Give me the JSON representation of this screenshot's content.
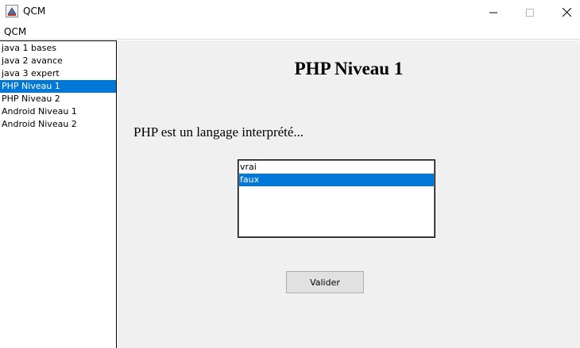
{
  "window": {
    "title": "QCM",
    "icon": "java-app-icon",
    "controls": [
      "minimize-icon",
      "maximize-icon",
      "close-icon"
    ]
  },
  "menu": {
    "items": [
      {
        "label": "QCM"
      }
    ]
  },
  "quiz_list": {
    "items": [
      {
        "label": "java 1 bases"
      },
      {
        "label": "java 2 avance"
      },
      {
        "label": "java 3 expert"
      },
      {
        "label": "PHP Niveau 1"
      },
      {
        "label": "PHP Niveau 2"
      },
      {
        "label": "Android Niveau 1"
      },
      {
        "label": "Android Niveau 2"
      }
    ],
    "selected_label": "PHP Niveau 1"
  },
  "quiz": {
    "title": "PHP Niveau 1",
    "question": "PHP est un langage interprété...",
    "answers": [
      {
        "label": "vrai"
      },
      {
        "label": "faux"
      }
    ],
    "selected_answer": "faux",
    "submit_label": "Valider"
  },
  "colors": {
    "selection": "#0078d7",
    "panel_background": "#f0f0f0",
    "button_background": "#e1e1e1"
  }
}
